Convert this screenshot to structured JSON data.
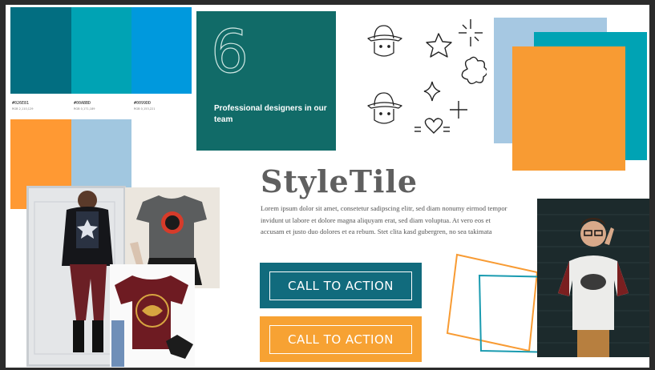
{
  "palette": {
    "swatches": [
      {
        "hex": "#026E81",
        "detail": "RGB  2,110,129",
        "color": "#026e81"
      },
      {
        "hex": "#00ABBD",
        "detail": "RGB  0,171,189",
        "color": "#00a3b4"
      },
      {
        "hex": "#0099DD",
        "detail": "RGB  0,153,221",
        "color": "#0099dd"
      },
      {
        "hex": "#FF9933",
        "detail": "",
        "color": "#ff9933"
      },
      {
        "hex": "#A1C7E0",
        "detail": "",
        "color": "#a1c7e0"
      }
    ]
  },
  "stat": {
    "number": "6",
    "caption": "Professional designers in our team"
  },
  "brand": {
    "title": "StyleTile",
    "body": "Lorem ipsum dolor sit amet, consetetur sadipscing elitr, sed diam nonumy eirmod tempor invidunt ut labore et dolore magna aliquyam erat, sed diam voluptua. At vero eos et accusam et justo duo dolores et ea rebum. Stet clita kasd gubergren, no sea takimata"
  },
  "cta_primary": {
    "label": "CALL TO ACTION",
    "color": "#116b7d"
  },
  "cta_secondary": {
    "label": "CALL TO ACTION",
    "color": "#f7a233"
  },
  "colors": {
    "teal": "#116b68",
    "orange": "#f89b33",
    "light_blue": "#a6c8e2",
    "cyan": "#00a3b4"
  },
  "icons": [
    "hat-character-icon",
    "star-icon",
    "sparkle-icon",
    "flower-icon",
    "heart-icon"
  ]
}
